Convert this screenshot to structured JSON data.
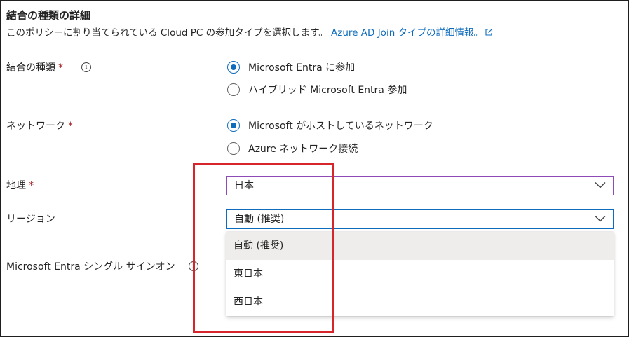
{
  "section": {
    "title": "結合の種類の詳細",
    "description": "このポリシーに割り当てられている Cloud PC の参加タイプを選択します。",
    "link_text": "Azure AD Join タイプの詳細情報。"
  },
  "join_type": {
    "label": "結合の種類",
    "required_mark": "*",
    "info_glyph": "i",
    "options": [
      {
        "label": "Microsoft Entra に参加",
        "checked": true
      },
      {
        "label": "ハイブリッド Microsoft Entra 参加",
        "checked": false
      }
    ]
  },
  "network": {
    "label": "ネットワーク",
    "required_mark": "*",
    "options": [
      {
        "label": "Microsoft がホストしているネットワーク",
        "checked": true
      },
      {
        "label": "Azure ネットワーク接続",
        "checked": false
      }
    ]
  },
  "geography": {
    "label": "地理",
    "required_mark": "*",
    "value": "日本"
  },
  "region": {
    "label": "リージョン",
    "value": "自動 (推奨)",
    "options": [
      "自動 (推奨)",
      "東日本",
      "西日本"
    ]
  },
  "sso": {
    "label": "Microsoft Entra シングル サインオン",
    "info_glyph": "i"
  },
  "colors": {
    "accent": "#0f6cbd",
    "required": "#a4262c",
    "highlight_box": "#d6262b",
    "selected_option_bg": "#efedeb"
  }
}
